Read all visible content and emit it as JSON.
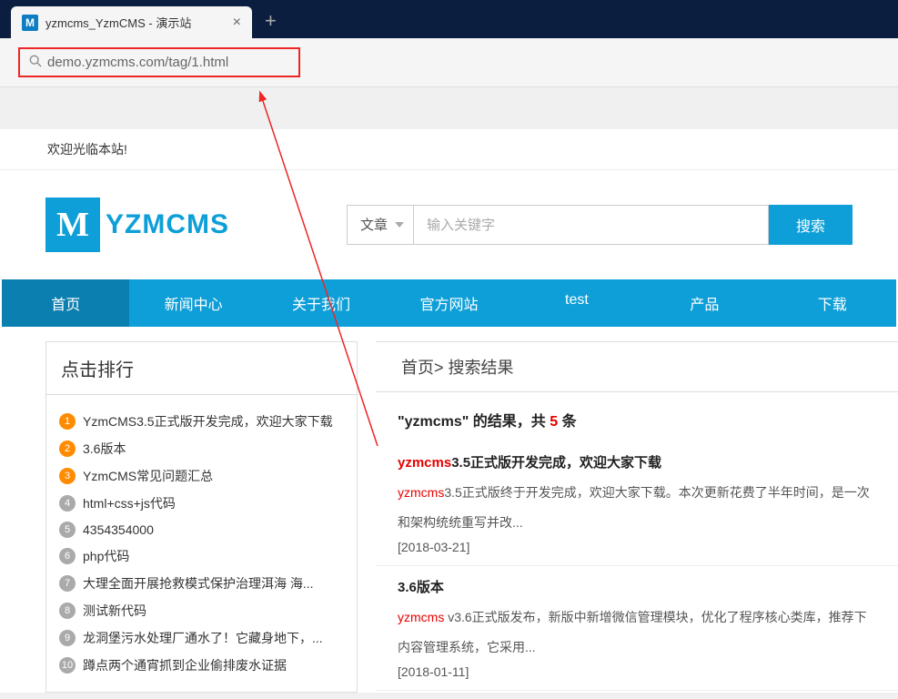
{
  "tab": {
    "favicon_letter": "M",
    "title": "yzmcms_YzmCMS - 演示站"
  },
  "url": "demo.yzmcms.com/tag/1.html",
  "welcome": "欢迎光临本站!",
  "logo": {
    "letter": "M",
    "text": "YZMCMS"
  },
  "search": {
    "category": "文章",
    "placeholder": "输入关键字",
    "button": "搜索"
  },
  "nav": [
    "首页",
    "新闻中心",
    "关于我们",
    "官方网站",
    "test",
    "产品",
    "下载"
  ],
  "sidebar": {
    "title": "点击排行",
    "items": [
      "YzmCMS3.5正式版开发完成，欢迎大家下载",
      "3.6版本",
      "YzmCMS常见问题汇总",
      "html+css+js代码",
      "4354354000",
      "php代码",
      "大理全面开展抢救模式保护治理洱海 海...",
      "测试新代码",
      "龙洞堡污水处理厂通水了！它藏身地下，...",
      "蹲点两个通宵抓到企业偷排废水证据"
    ]
  },
  "breadcrumb": {
    "home": "首页",
    "sep": ">",
    "current": "搜索结果"
  },
  "results_header": {
    "prefix": "\"yzmcms\" 的结果，共 ",
    "count": "5",
    "suffix": " 条"
  },
  "results": [
    {
      "title_hl": "yzmcms",
      "title_rest": "3.5正式版开发完成，欢迎大家下载",
      "desc_hl": "yzmcms",
      "desc_rest": "3.5正式版终于开发完成，欢迎大家下载。本次更新花费了半年时间，是一次",
      "desc_line2": "和架构统统重写并改...",
      "date": "[2018-03-21]"
    },
    {
      "title_hl": "",
      "title_rest": "3.6版本",
      "desc_hl": "yzmcms",
      "desc_rest": " v3.6正式版发布，新版中新增微信管理模块，优化了程序核心类库，推荐下",
      "desc_line2": "内容管理系统，它采用...",
      "date": "[2018-01-11]"
    }
  ]
}
